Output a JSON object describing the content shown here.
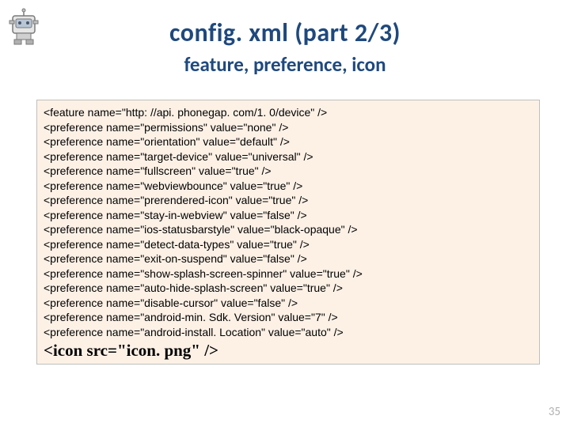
{
  "title": "config. xml (part 2/3)",
  "subtitle": "feature, preference, icon",
  "code_lines": [
    "<feature name=\"http: //api. phonegap. com/1. 0/device\" />",
    "<preference name=\"permissions\" value=\"none\" />",
    "<preference name=\"orientation\" value=\"default\" />",
    "<preference name=\"target-device\" value=\"universal\" />",
    "<preference name=\"fullscreen\" value=\"true\" />",
    "<preference name=\"webviewbounce\" value=\"true\" />",
    "<preference name=\"prerendered-icon\" value=\"true\" />",
    "<preference name=\"stay-in-webview\" value=\"false\" />",
    "<preference name=\"ios-statusbarstyle\" value=\"black-opaque\" />",
    "<preference name=\"detect-data-types\" value=\"true\" />",
    "<preference name=\"exit-on-suspend\" value=\"false\" />",
    "<preference name=\"show-splash-screen-spinner\" value=\"true\" />",
    "<preference name=\"auto-hide-splash-screen\" value=\"true\" />",
    "<preference name=\"disable-cursor\" value=\"false\" />",
    "<preference name=\"android-min. Sdk. Version\" value=\"7\" />",
    "<preference name=\"android-install. Location\" value=\"auto\" />"
  ],
  "icon_line": "<icon src=\"icon. png\" />",
  "page_number": "35"
}
